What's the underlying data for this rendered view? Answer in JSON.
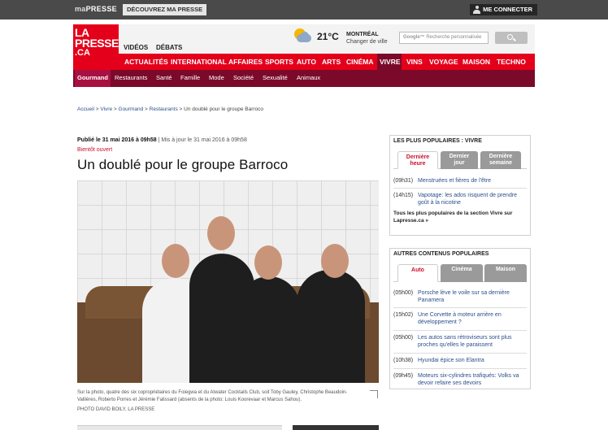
{
  "topbar": {
    "brand_a": "ma",
    "brand_b": "PRESSE",
    "discover": "DÉCOUVREZ MA PRESSE",
    "login": "ME CONNECTER"
  },
  "logo": {
    "line1": "LA",
    "line2": "PRESSE",
    "line3": ".CA"
  },
  "header": {
    "links": [
      "VIDÉOS",
      "DÉBATS"
    ],
    "temperature": "21°C",
    "city": "MONTRÉAL",
    "change_city": "Changer de ville",
    "search_placeholder": "Recherche personnalisée",
    "search_brand": "Google™"
  },
  "main_nav": [
    "ACTUALITÉS",
    "INTERNATIONAL",
    "AFFAIRES",
    "SPORTS",
    "AUTO",
    "ARTS",
    "CINÉMA",
    "VIVRE",
    "VINS",
    "VOYAGE",
    "MAISON",
    "TECHNO"
  ],
  "main_nav_active": "VIVRE",
  "sub_nav": [
    "Gourmand",
    "Restaurants",
    "Santé",
    "Famille",
    "Mode",
    "Société",
    "Sexualité",
    "Animaux"
  ],
  "sub_nav_active": "Gourmand",
  "breadcrumb": {
    "items": [
      "Accueil",
      "Vivre",
      "Gourmand",
      "Restaurants"
    ],
    "separator": ">",
    "current": "Un doublé pour le groupe Barroco"
  },
  "article": {
    "published": "Publié le 31 mai 2016 à 09h58",
    "updated": "| Mis à jour le 31 mai 2016 à 09h58",
    "kicker": "Bientôt ouvert",
    "title": "Un doublé pour le groupe Barroco",
    "caption": "Sur la photo, quatre des six copropriétaires du Foiegwa et du Atwater Cocktails Club, soit Toby Gauley, Christophe Beaudoin-Vallières, Roberto Porres et Jérémie Falissard (absents de la photo: Louis Koorevaar et Marcus Sahou).",
    "credit": "PHOTO DAVID BOILY, LA PRESSE"
  },
  "popular": {
    "heading": "LES PLUS POPULAIRES : VIVRE",
    "tabs": [
      {
        "l1": "Dernière",
        "l2": "heure"
      },
      {
        "l1": "Dernier",
        "l2": "jour"
      },
      {
        "l1": "Dernière",
        "l2": "semaine"
      }
    ],
    "items": [
      {
        "time": "(09h31)",
        "text": "Menstruées et fières de l'être"
      },
      {
        "time": "(14h15)",
        "text": "Vapotage: les ados risquent de prendre goût à la nicotine"
      }
    ],
    "note": "Tous les plus populaires de la section Vivre sur",
    "note_link": "Lapresse.ca »"
  },
  "others": {
    "heading": "AUTRES CONTENUS POPULAIRES",
    "tabs": [
      "Auto",
      "Cinéma",
      "Maison"
    ],
    "items": [
      {
        "time": "(05h00)",
        "text": "Porsche lève le voile sur sa dernière Panamera"
      },
      {
        "time": "(15h02)",
        "text": "Une Corvette à moteur arrière en développement ?"
      },
      {
        "time": "(05h00)",
        "text": "Les autos sans rétroviseurs sont plus proches qu'elles le paraissent"
      },
      {
        "time": "(10h38)",
        "text": "Hyundai épice son Elantra"
      },
      {
        "time": "(09h45)",
        "text": "Moteurs six-cylindres trafiqués: Volks va devoir refaire ses devoirs"
      }
    ]
  }
}
